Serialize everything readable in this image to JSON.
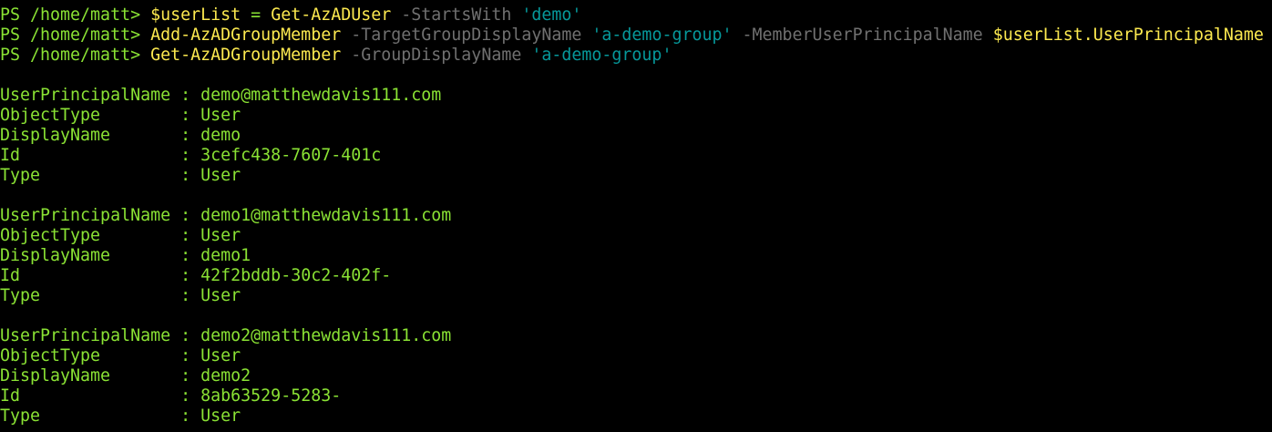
{
  "commands": [
    {
      "prompt": "PS /home/matt> ",
      "tokens": [
        {
          "t": "var",
          "v": "$userList"
        },
        {
          "t": "plain",
          "v": " = "
        },
        {
          "t": "cmd",
          "v": "Get-AzADUser"
        },
        {
          "t": "plain",
          "v": " "
        },
        {
          "t": "param",
          "v": "-StartsWith"
        },
        {
          "t": "plain",
          "v": " "
        },
        {
          "t": "str",
          "v": "'demo'"
        }
      ]
    },
    {
      "prompt": "PS /home/matt> ",
      "tokens": [
        {
          "t": "cmd",
          "v": "Add-AzADGroupMember"
        },
        {
          "t": "plain",
          "v": " "
        },
        {
          "t": "param",
          "v": "-TargetGroupDisplayName"
        },
        {
          "t": "plain",
          "v": " "
        },
        {
          "t": "str",
          "v": "'a-demo-group'"
        },
        {
          "t": "plain",
          "v": " "
        },
        {
          "t": "param",
          "v": "-MemberUserPrincipalName"
        },
        {
          "t": "plain",
          "v": " "
        },
        {
          "t": "var",
          "v": "$userList"
        },
        {
          "t": "prop",
          "v": ".UserPrincipalName"
        }
      ]
    },
    {
      "prompt": "PS /home/matt> ",
      "tokens": [
        {
          "t": "cmd",
          "v": "Get-AzADGroupMember"
        },
        {
          "t": "plain",
          "v": " "
        },
        {
          "t": "param",
          "v": "-GroupDisplayName"
        },
        {
          "t": "plain",
          "v": " "
        },
        {
          "t": "str",
          "v": "'a-demo-group'"
        }
      ]
    }
  ],
  "output_records": [
    [
      {
        "key": "UserPrincipalName",
        "sep": " : ",
        "value": "demo@matthewdavis111.com"
      },
      {
        "key": "ObjectType       ",
        "sep": " : ",
        "value": "User"
      },
      {
        "key": "DisplayName      ",
        "sep": " : ",
        "value": "demo"
      },
      {
        "key": "Id               ",
        "sep": " : ",
        "value": "3cefc438-7607-401c"
      },
      {
        "key": "Type             ",
        "sep": " : ",
        "value": "User"
      }
    ],
    [
      {
        "key": "UserPrincipalName",
        "sep": " : ",
        "value": "demo1@matthewdavis111.com"
      },
      {
        "key": "ObjectType       ",
        "sep": " : ",
        "value": "User"
      },
      {
        "key": "DisplayName      ",
        "sep": " : ",
        "value": "demo1"
      },
      {
        "key": "Id               ",
        "sep": " : ",
        "value": "42f2bddb-30c2-402f-"
      },
      {
        "key": "Type             ",
        "sep": " : ",
        "value": "User"
      }
    ],
    [
      {
        "key": "UserPrincipalName",
        "sep": " : ",
        "value": "demo2@matthewdavis111.com"
      },
      {
        "key": "ObjectType       ",
        "sep": " : ",
        "value": "User"
      },
      {
        "key": "DisplayName      ",
        "sep": " : ",
        "value": "demo2"
      },
      {
        "key": "Id               ",
        "sep": " : ",
        "value": "8ab63529-5283-"
      },
      {
        "key": "Type             ",
        "sep": " : ",
        "value": "User"
      }
    ]
  ],
  "colors": {
    "background": "#000000",
    "prompt": "#8ae234",
    "command": "#fce94f",
    "parameter": "#707070",
    "string": "#06989a",
    "output": "#8ae234"
  }
}
